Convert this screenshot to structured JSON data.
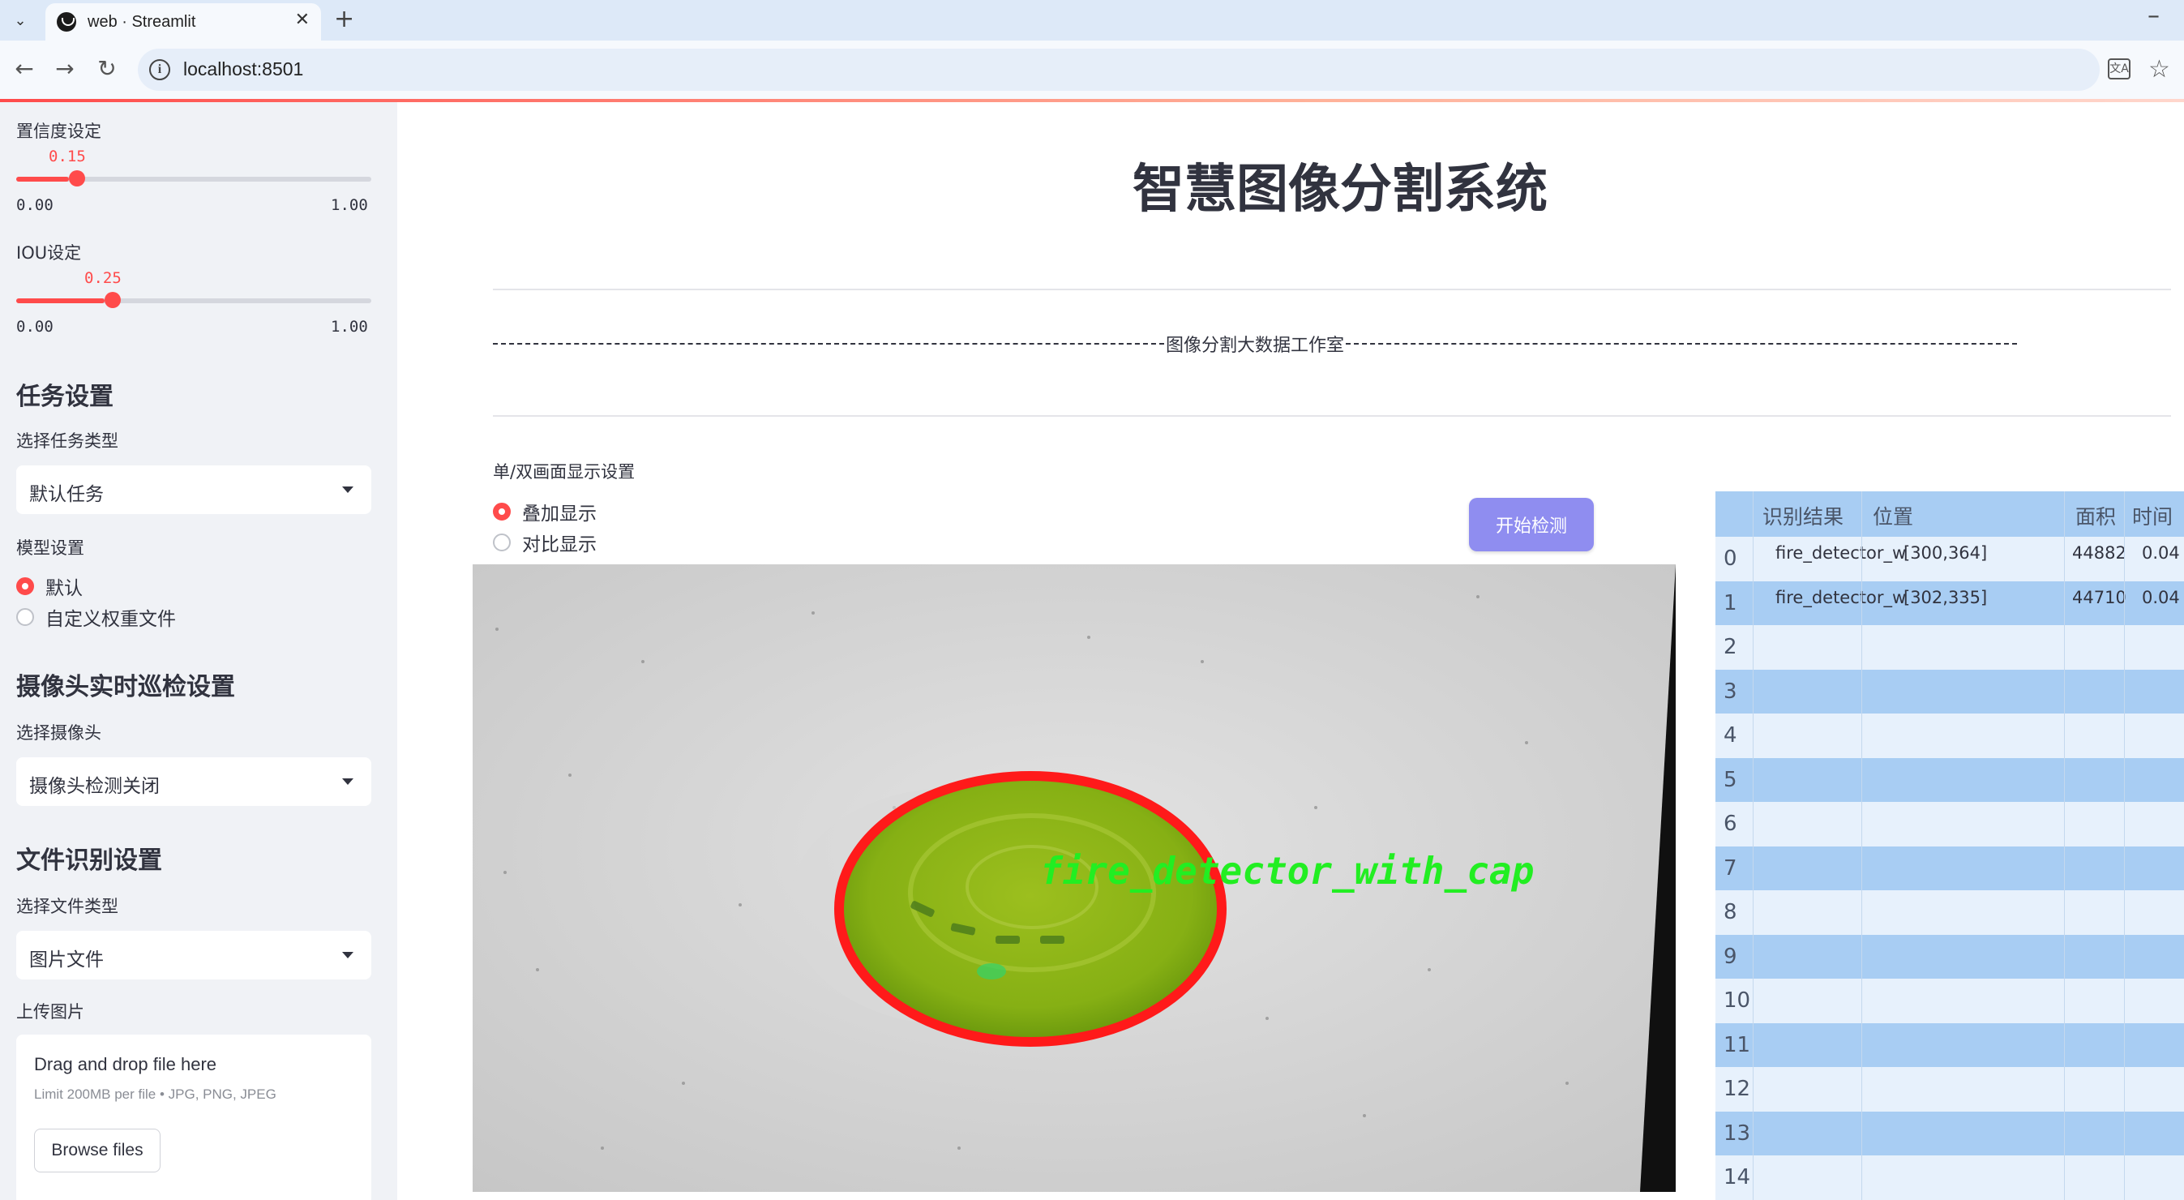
{
  "browser": {
    "tab_title": "web · Streamlit",
    "url": "localhost:8501"
  },
  "sidebar": {
    "confidence": {
      "label": "置信度设定",
      "value": "0.15",
      "value_fraction": 0.15,
      "min": "0.00",
      "max": "1.00"
    },
    "iou": {
      "label": "IOU设定",
      "value": "0.25",
      "value_fraction": 0.25,
      "min": "0.00",
      "max": "1.00"
    },
    "task_settings": {
      "heading": "任务设置",
      "label": "选择任务类型",
      "selected": "默认任务"
    },
    "model_settings": {
      "label": "模型设置",
      "options": [
        "默认",
        "自定义权重文件"
      ],
      "selected_index": 0
    },
    "camera_settings": {
      "heading": "摄像头实时巡检设置",
      "label": "选择摄像头",
      "selected": "摄像头检测关闭"
    },
    "file_settings": {
      "heading": "文件识别设置",
      "label": "选择文件类型",
      "selected": "图片文件"
    },
    "upload": {
      "label": "上传图片",
      "title": "Drag and drop file here",
      "limit": "Limit 200MB per file • JPG, PNG, JPEG",
      "button": "Browse files"
    }
  },
  "main": {
    "title": "智慧图像分割系统",
    "subtitle": "图像分割大数据工作室",
    "display_label": "单/双画面显示设置",
    "display_options": [
      "叠加显示",
      "对比显示"
    ],
    "display_selected_index": 0,
    "start_button": "开始检测",
    "detection_label": "fire_detector_with_cap"
  },
  "table": {
    "headers": [
      "识别结果",
      "位置",
      "面积",
      "时间"
    ],
    "rows": [
      {
        "index": "0",
        "result": "fire_detector_w",
        "position": "[300,364]",
        "area": "44882",
        "time": "0.04"
      },
      {
        "index": "1",
        "result": "fire_detector_w",
        "position": "[302,335]",
        "area": "44710",
        "time": "0.04"
      },
      {
        "index": "2"
      },
      {
        "index": "3"
      },
      {
        "index": "4"
      },
      {
        "index": "5"
      },
      {
        "index": "6"
      },
      {
        "index": "7"
      },
      {
        "index": "8"
      },
      {
        "index": "9"
      },
      {
        "index": "10"
      },
      {
        "index": "11"
      },
      {
        "index": "12"
      },
      {
        "index": "13"
      },
      {
        "index": "14"
      }
    ]
  },
  "colors": {
    "accent": "#ff4b4b",
    "button": "#8f8df0",
    "table_header": "#a8cdf3",
    "sidebar_bg": "#f0f2f6"
  }
}
